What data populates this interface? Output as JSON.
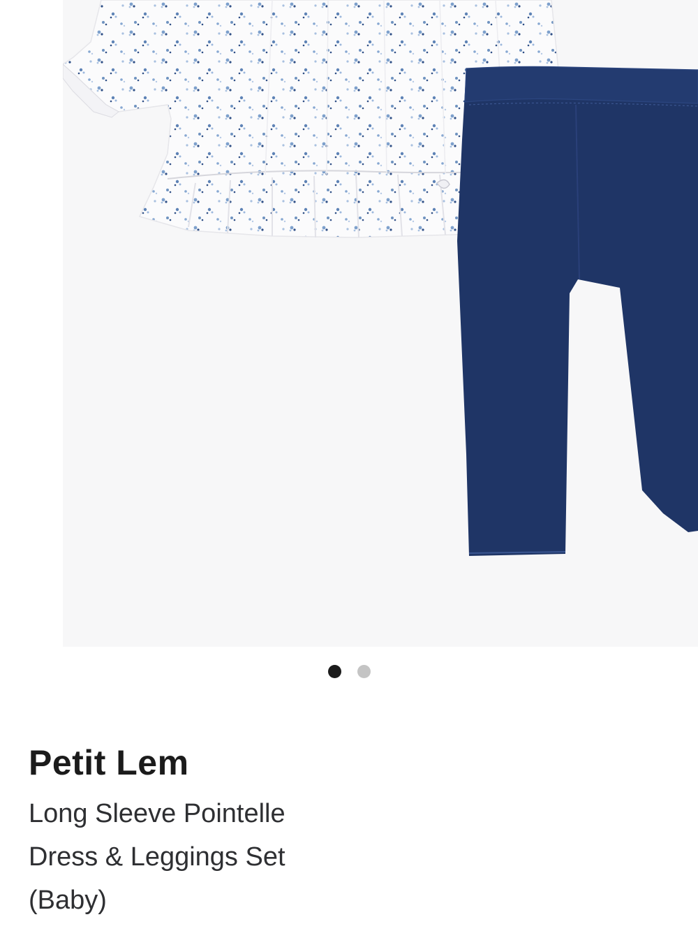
{
  "gallery": {
    "image_alt": "Petit Lem Long Sleeve Pointelle Dress & Leggings Set (Baby)",
    "slide_count": 2,
    "active_slide": 1,
    "colors": {
      "background": "#f7f7f8",
      "dress": "#fbfbfc",
      "print": "#6f93c0",
      "leggings": "#1f3566"
    }
  },
  "product": {
    "brand": "Petit Lem",
    "title": "Long Sleeve Pointelle Dress & Leggings Set (Baby)"
  }
}
